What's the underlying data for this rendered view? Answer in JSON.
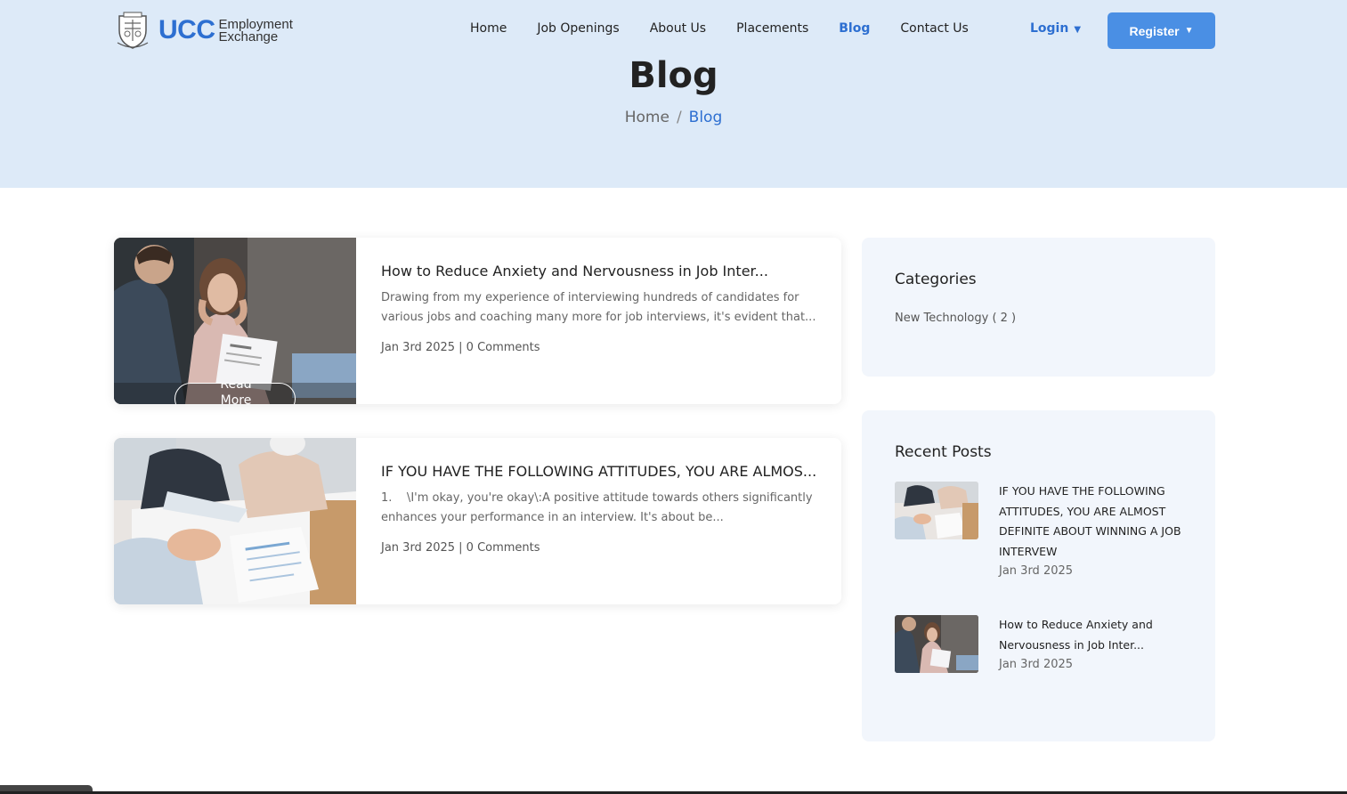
{
  "brand": {
    "name": "UCC",
    "sub_line1": "Employment",
    "sub_line2": "Exchange"
  },
  "nav": {
    "items": [
      {
        "label": "Home"
      },
      {
        "label": "Job Openings"
      },
      {
        "label": "About Us"
      },
      {
        "label": "Placements"
      },
      {
        "label": "Blog"
      },
      {
        "label": "Contact Us"
      }
    ],
    "active": "Blog",
    "login_label": "Login",
    "register_label": "Register",
    "caret": "▼"
  },
  "hero": {
    "title": "Blog",
    "breadcrumb_home": "Home",
    "breadcrumb_sep": "/",
    "breadcrumb_current": "Blog"
  },
  "posts": [
    {
      "title": "How to Reduce Anxiety and Nervousness in Job Inter...",
      "excerpt": "Drawing from my experience of interviewing hundreds of candidates for various jobs and coaching many more for job interviews, it's evident that...",
      "meta": "Jan 3rd 2025 | 0 Comments",
      "read_more": "Read More"
    },
    {
      "title": "IF YOU HAVE THE FOLLOWING ATTITUDES, YOU ARE ALMOS...",
      "excerpt": "1.    \\I'm okay, you're okay\\:A positive attitude towards others significantly enhances your performance in an interview. It's about be...",
      "meta": "Jan 3rd 2025 | 0 Comments"
    }
  ],
  "sidebar": {
    "categories_heading": "Categories",
    "categories": [
      {
        "label": "New Technology ( 2 )"
      }
    ],
    "recent_heading": "Recent Posts",
    "recent": [
      {
        "title": "IF YOU HAVE THE FOLLOWING ATTITUDES, YOU ARE ALMOST DEFINITE ABOUT WINNING A JOB INTERVEW",
        "date": "Jan 3rd 2025"
      },
      {
        "title": "How to Reduce Anxiety and Nervousness in Job Inter...",
        "date": "Jan 3rd 2025"
      }
    ]
  },
  "colors": {
    "accent": "#2d6fd1",
    "button": "#4a8fe4",
    "hero_bg": "#ddeaf8",
    "sidebar_bg": "#f2f6fc"
  }
}
